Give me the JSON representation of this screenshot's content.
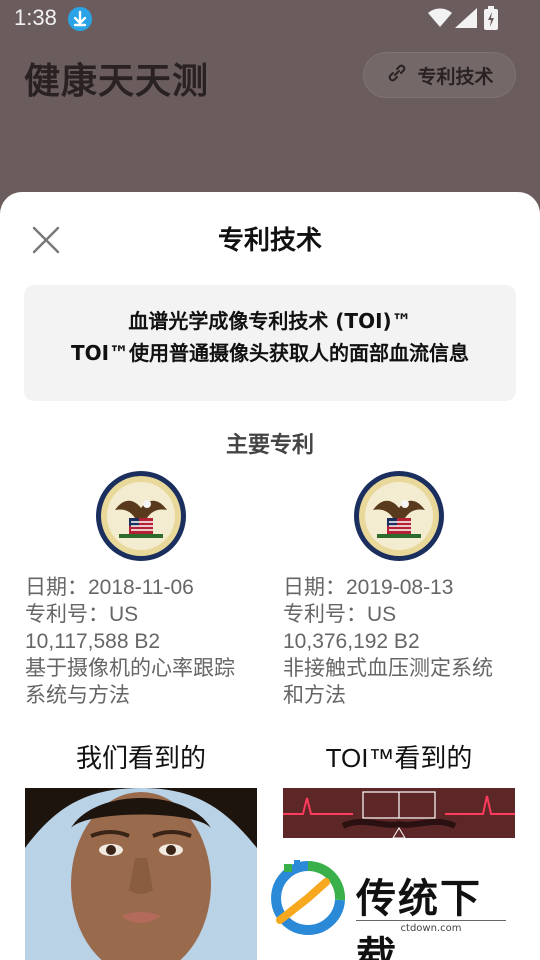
{
  "statusbar": {
    "time": "1:38"
  },
  "background": {
    "app_title": "健康天天测",
    "patent_button": "专利技术"
  },
  "sheet": {
    "title": "专利技术",
    "tech": {
      "line1": "血谱光学成像专利技术 (TOI)™",
      "line2": "TOI™使用普通摄像头获取人的面部血流信息"
    },
    "section_title": "主要专利",
    "patents": [
      {
        "date": "日期：2018-11-06",
        "number_label": "专利号：US",
        "number": "10,117,588 B2",
        "desc1": "基于摄像机的心率跟踪",
        "desc2": "系统与方法"
      },
      {
        "date": "日期：2019-08-13",
        "number_label": "专利号：US",
        "number": "10,376,192 B2",
        "desc1": "非接触式血压测定系统",
        "desc2": "和方法"
      }
    ],
    "views": {
      "left": "我们看到的",
      "right": "TOI™看到的"
    }
  },
  "watermark": {
    "name": "传统下载",
    "url": "ctdown.com"
  }
}
